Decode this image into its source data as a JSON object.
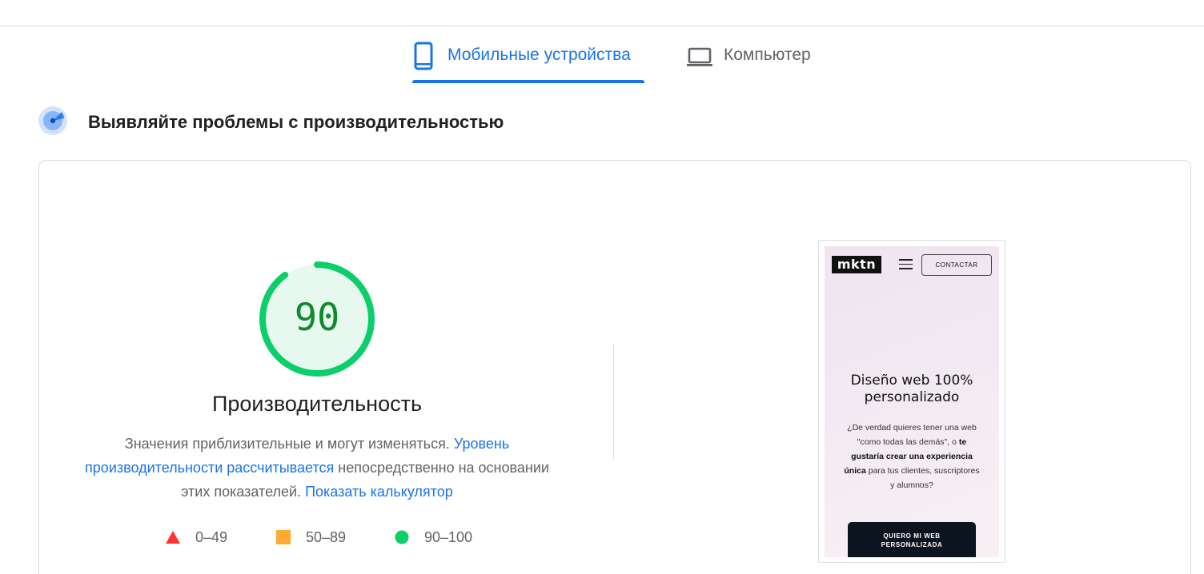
{
  "tabs": {
    "mobile": {
      "label": "Мобильные устройства",
      "icon": "smartphone-icon",
      "active": true
    },
    "desktop": {
      "label": "Компьютер",
      "icon": "laptop-icon",
      "active": false
    }
  },
  "section": {
    "icon": "performance-radar-icon",
    "title": "Выявляйте проблемы с производительностью"
  },
  "gauge": {
    "score": "90",
    "score_fraction": 0.9,
    "color": "#0cce6b",
    "fill": "#e7f8ee",
    "text_color": "#0d8a2b"
  },
  "performance": {
    "title": "Производительность",
    "desc_1": "Значения приблизительные и могут изменяться. ",
    "link_1": "Уровень производительности рассчитывается",
    "desc_2": " непосредственно на основании этих показателей. ",
    "link_2": "Показать калькулятор"
  },
  "legend": {
    "fail": {
      "range": "0–49",
      "color": "#ff3333"
    },
    "average": {
      "range": "50–89",
      "color": "#ffaa33"
    },
    "pass": {
      "range": "90–100",
      "color": "#0cce6b"
    }
  },
  "screenshot": {
    "logo": "mktn",
    "contact_label": "CONTACTAR",
    "headline_1": "Diseño web 100%",
    "headline_2": "personalizado",
    "body_1": "¿De verdad quieres tener una web \"como todas las demás\", o ",
    "body_bold": "te gustaría crear una experiencia única",
    "body_2": " para tus clientes, suscriptores y alumnos?",
    "cta_1": "QUIERO MI WEB",
    "cta_2": "PERSONALIZADA"
  },
  "colors": {
    "accent": "#1a73e8",
    "border": "#dadce0",
    "muted_text": "#5f6368"
  }
}
